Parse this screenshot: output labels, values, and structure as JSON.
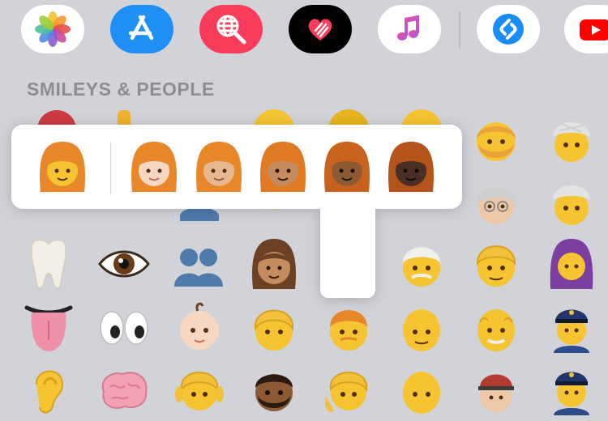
{
  "app_strip": {
    "apps": [
      {
        "name": "Photos",
        "icon": "photos-icon"
      },
      {
        "name": "App Store",
        "icon": "app-store-icon"
      },
      {
        "name": "Web Images Search",
        "icon": "globe-search-icon"
      },
      {
        "name": "Digital Touch",
        "icon": "digital-touch-icon"
      },
      {
        "name": "Music",
        "icon": "music-icon"
      },
      {
        "name": "Shazam",
        "icon": "shazam-icon"
      },
      {
        "name": "YouTube",
        "icon": "youtube-icon"
      }
    ]
  },
  "category": {
    "title": "SMILEYS & PEOPLE"
  },
  "skin_tone_picker": {
    "base_emoji": "woman-red-hair",
    "tones": [
      "light",
      "medium-light",
      "medium",
      "medium-dark",
      "dark"
    ],
    "colors": {
      "hair": "#e8862a",
      "default_skin": "#f7c431",
      "light": "#f6d8c2",
      "medium-light": "#e5b890",
      "medium": "#c58d5f",
      "medium-dark": "#8d5a34",
      "dark": "#4a2f24"
    }
  },
  "emoji_grid": {
    "rows": [
      [
        "tooth",
        "eye",
        "busts-in-silhouette",
        "woman-medium-skin",
        "",
        "man-white-hair",
        "man-blond-hair",
        "woman-with-headscarf"
      ],
      [
        "tongue",
        "eyes",
        "baby-light-skin",
        "person-blond-hair",
        "man-red-hair",
        "man-bald",
        "old-man",
        "woman-police-officer"
      ],
      [
        "ear",
        "brain",
        "girl",
        "man-dark-skin-beard",
        "woman-blond-hair",
        "bald-person",
        "person-cap",
        "police-officer"
      ]
    ]
  }
}
